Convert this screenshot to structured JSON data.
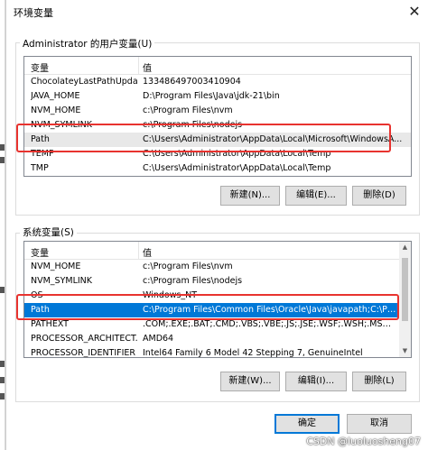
{
  "window": {
    "title": "环境变量",
    "close_glyph": "✕"
  },
  "user_vars": {
    "group_label": "Administrator 的用户变量(U)",
    "columns": [
      "变量",
      "值"
    ],
    "rows": [
      {
        "name": "ChocolateyLastPathUpdate",
        "value": "133486497003410904"
      },
      {
        "name": "JAVA_HOME",
        "value": "D:\\Program Files\\Java\\jdk-21\\bin"
      },
      {
        "name": "NVM_HOME",
        "value": "c:\\Program Files\\nvm"
      },
      {
        "name": "NVM_SYMLINK",
        "value": "c:\\Program Files\\nodejs"
      },
      {
        "name": "Path",
        "value": "C:\\Users\\Administrator\\AppData\\Local\\Microsoft\\WindowsA..."
      },
      {
        "name": "TEMP",
        "value": "C:\\Users\\Administrator\\AppData\\Local\\Temp"
      },
      {
        "name": "TMP",
        "value": "C:\\Users\\Administrator\\AppData\\Local\\Temp"
      }
    ],
    "buttons": {
      "new": "新建(N)...",
      "edit": "编辑(E)...",
      "delete": "删除(D)"
    }
  },
  "system_vars": {
    "group_label": "系统变量(S)",
    "columns": [
      "变量",
      "值"
    ],
    "rows": [
      {
        "name": "NVM_HOME",
        "value": "c:\\Program Files\\nvm"
      },
      {
        "name": "NVM_SYMLINK",
        "value": "c:\\Program Files\\nodejs"
      },
      {
        "name": "OS",
        "value": "Windows_NT"
      },
      {
        "name": "Path",
        "value": "C:\\Program Files\\Common Files\\Oracle\\Java\\javapath;C:\\Pyth..."
      },
      {
        "name": "PATHEXT",
        "value": ".COM;.EXE;.BAT;.CMD;.VBS;.VBE;.JS;.JSE;.WSF;.WSH;.MSC;.PY;.P..."
      },
      {
        "name": "PROCESSOR_ARCHITECT...",
        "value": "AMD64"
      },
      {
        "name": "PROCESSOR_IDENTIFIER",
        "value": "Intel64 Family 6 Model 42 Stepping 7, GenuineIntel"
      }
    ],
    "buttons": {
      "new": "新建(W)...",
      "edit": "编辑(I)...",
      "delete": "删除(L)"
    }
  },
  "footer": {
    "ok": "确定",
    "cancel": "取消"
  },
  "watermark": "CSDN @luoluosheng07"
}
